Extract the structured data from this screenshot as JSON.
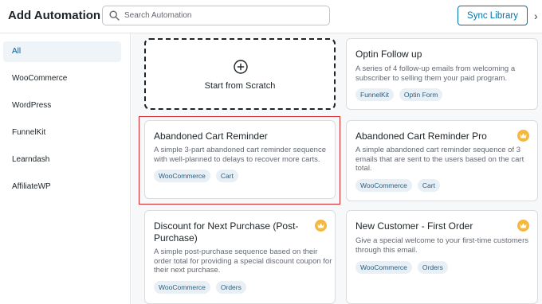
{
  "header": {
    "title": "Add Automation",
    "search_placeholder": "Search Automation",
    "search_value": "",
    "sync_label": "Sync Library",
    "close_glyph": "›"
  },
  "sidebar": {
    "items": [
      {
        "label": "All",
        "active": true
      },
      {
        "label": "WooCommerce",
        "active": false
      },
      {
        "label": "WordPress",
        "active": false
      },
      {
        "label": "FunnelKit",
        "active": false
      },
      {
        "label": "Learndash",
        "active": false
      },
      {
        "label": "AffiliateWP",
        "active": false
      }
    ]
  },
  "scratch": {
    "label": "Start from Scratch",
    "icon": "plus-circle-icon"
  },
  "cards": [
    {
      "title": "Optin Follow up",
      "desc_lines": [
        "A series of 4 follow-up emails from welcoming a",
        "subscriber to selling them your paid program."
      ],
      "tags": [
        "FunnelKit",
        "Optin Form"
      ],
      "pro": false
    },
    {
      "title": "Abandoned Cart Reminder",
      "desc_lines": [
        "A simple 3-part abandoned cart reminder sequence",
        "with well-planned to delays to recover more carts."
      ],
      "tags": [
        "WooCommerce",
        "Cart"
      ],
      "pro": false
    },
    {
      "title": "Abandoned Cart Reminder Pro",
      "desc_lines": [
        "A simple abandoned cart reminder sequence of 3",
        "emails that are sent to the users based on the cart",
        "total."
      ],
      "tags": [
        "WooCommerce",
        "Cart"
      ],
      "pro": true
    },
    {
      "title_lines": [
        "Discount for Next Purchase (Post-",
        "Purchase)"
      ],
      "desc_lines": [
        "A simple post-purchase sequence based on their",
        "order total for providing a special discount coupon for",
        "their next purchase."
      ],
      "tags": [
        "WooCommerce",
        "Orders"
      ],
      "pro": true
    },
    {
      "title": "New Customer - First Order",
      "desc_lines": [
        "Give a special welcome to your first-time customers",
        "through this email."
      ],
      "tags": [
        "WooCommerce",
        "Orders"
      ],
      "pro": true
    }
  ],
  "colors": {
    "accent": "#0073aa",
    "highlight": "#d1262b",
    "crown": "#f5b83d",
    "tag_bg": "#e8f0f5",
    "tag_text": "#2b5f82"
  }
}
